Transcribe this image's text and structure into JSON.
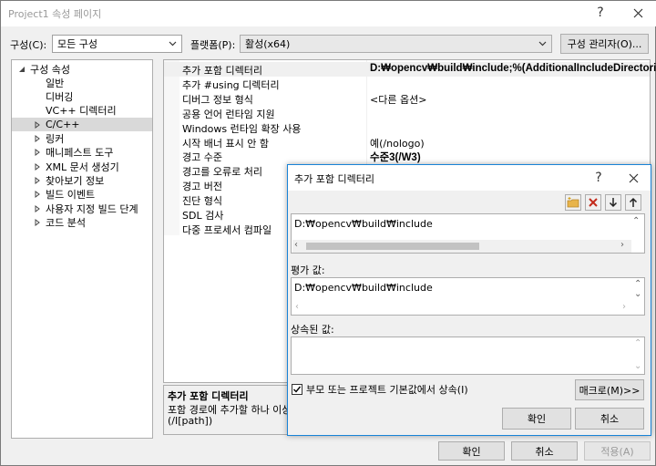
{
  "window": {
    "title": "Project1 속성 페이지",
    "help_glyph": "?",
    "close_glyph": "✕"
  },
  "toolbar": {
    "config_label": "구성(C):",
    "config_value": "모든 구성",
    "platform_label": "플랫폼(P):",
    "platform_value": "활성(x64)",
    "config_manager_label": "구성 관리자(O)..."
  },
  "tree": {
    "items": [
      {
        "label": "구성 속성",
        "level": 0,
        "expander": "open"
      },
      {
        "label": "일반",
        "level": 1,
        "expander": "none"
      },
      {
        "label": "디버깅",
        "level": 1,
        "expander": "none"
      },
      {
        "label": "VC++ 디렉터리",
        "level": 1,
        "expander": "none"
      },
      {
        "label": "C/C++",
        "level": 1,
        "expander": "closed",
        "selected": true
      },
      {
        "label": "링커",
        "level": 1,
        "expander": "closed"
      },
      {
        "label": "매니페스트 도구",
        "level": 1,
        "expander": "closed"
      },
      {
        "label": "XML 문서 생성기",
        "level": 1,
        "expander": "closed"
      },
      {
        "label": "찾아보기 정보",
        "level": 1,
        "expander": "closed"
      },
      {
        "label": "빌드 이벤트",
        "level": 1,
        "expander": "closed"
      },
      {
        "label": "사용자 지정 빌드 단계",
        "level": 1,
        "expander": "closed"
      },
      {
        "label": "코드 분석",
        "level": 1,
        "expander": "closed"
      }
    ]
  },
  "grid": {
    "rows": [
      {
        "name": "추가 포함 디렉터리",
        "value": "D:₩opencv₩build₩include;%(AdditionalIncludeDirectories)",
        "bold": true,
        "selected": true
      },
      {
        "name": "추가 #using 디렉터리",
        "value": "",
        "bold": false
      },
      {
        "name": "디버그 정보 형식",
        "value": "<다른 옵션>",
        "bold": false
      },
      {
        "name": "공용 언어 런타임 지원",
        "value": "",
        "bold": false
      },
      {
        "name": "Windows 런타임 확장 사용",
        "value": "",
        "bold": false
      },
      {
        "name": "시작 배너 표시 안 함",
        "value": "예(/nologo)",
        "bold": false
      },
      {
        "name": "경고 수준",
        "value": "수준3(/W3)",
        "bold": true
      },
      {
        "name": "경고를 오류로 처리",
        "value": "",
        "bold": false
      },
      {
        "name": "경고 버전",
        "value": "",
        "bold": false
      },
      {
        "name": "진단 형식",
        "value": "",
        "bold": false
      },
      {
        "name": "SDL 검사",
        "value": "",
        "bold": false
      },
      {
        "name": "다중 프로세서 컴파일",
        "value": "",
        "bold": false
      }
    ]
  },
  "description": {
    "title": "추가 포함 디렉터리",
    "text": "포함 경로에 추가할 하나 이상",
    "switch": "(/I[path])"
  },
  "bottom_buttons": {
    "ok": "확인",
    "cancel": "취소",
    "apply": "적용(A)"
  },
  "dialog": {
    "title": "추가 포함 디렉터리",
    "help_glyph": "?",
    "close_glyph": "✕",
    "edit_value": "D:₩opencv₩build₩include",
    "evaluated_label": "평가 값:",
    "evaluated_value": "D:₩opencv₩build₩include",
    "inherited_label": "상속된 값:",
    "inherit_checkbox_label": "부모 또는 프로젝트 기본값에서 상속(I)",
    "inherit_checked": true,
    "macro_button": "매크로(M)>>",
    "ok": "확인",
    "cancel": "취소",
    "colors": {
      "border": "#1883d7",
      "delete_icon": "#c42b1c",
      "folder_icon": "#e8b44a"
    }
  }
}
